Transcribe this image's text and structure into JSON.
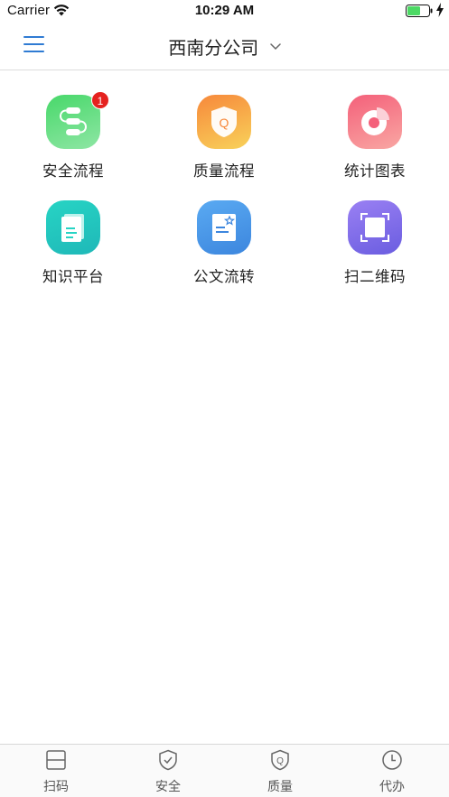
{
  "status_bar": {
    "carrier": "Carrier",
    "time": "10:29 AM",
    "battery_color": "#4cd964"
  },
  "nav": {
    "title": "西南分公司"
  },
  "apps": [
    {
      "label": "安全流程",
      "icon": "flow-icon",
      "badge": "1",
      "color": "#48d86a"
    },
    {
      "label": "质量流程",
      "icon": "quality-shield-icon",
      "badge": null,
      "color": "#f7883b"
    },
    {
      "label": "统计图表",
      "icon": "pie-chart-icon",
      "badge": null,
      "color": "#f4607a"
    },
    {
      "label": "知识平台",
      "icon": "document-icon",
      "badge": null,
      "color": "#27d4c4"
    },
    {
      "label": "公文流转",
      "icon": "doc-star-icon",
      "badge": null,
      "color": "#5aaaf2"
    },
    {
      "label": "扫二维码",
      "icon": "scan-icon",
      "badge": null,
      "color": "#8a72ee"
    }
  ],
  "tabs": [
    {
      "label": "扫码",
      "icon": "scan-tab-icon"
    },
    {
      "label": "安全",
      "icon": "shield-check-icon"
    },
    {
      "label": "质量",
      "icon": "shield-q-icon"
    },
    {
      "label": "代办",
      "icon": "clock-icon"
    }
  ],
  "colors": {
    "accent": "#2f7bd3",
    "badge": "#e5221f"
  }
}
